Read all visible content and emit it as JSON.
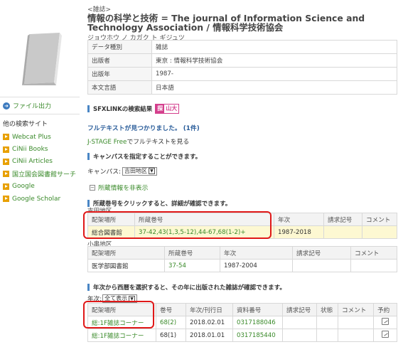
{
  "header": {
    "type_label": "<雑誌>",
    "title": "情報の科学と技術 = The journal of Information Science and Technology Association / 情報科学技術協会",
    "reading": "ジョウホウ ノ カガク ト ギジュツ"
  },
  "metadata": [
    {
      "key": "データ種別",
      "value": "雑誌"
    },
    {
      "key": "出版者",
      "value": "東京 : 情報科学技術協会"
    },
    {
      "key": "出版年",
      "value": "1987-"
    },
    {
      "key": "本文言語",
      "value": "日本語"
    }
  ],
  "sidebar": {
    "export_label": "ファイル出力",
    "other_sites_heading": "他の検索サイト",
    "sites": [
      {
        "label": "Webcat Plus"
      },
      {
        "label": "CiNii Books"
      },
      {
        "label": "CiNii Articles"
      },
      {
        "label": "国立国会図書館サーチ"
      },
      {
        "label": "Google"
      },
      {
        "label": "Google Scholar"
      }
    ]
  },
  "sfx": {
    "section_title": "SFXLINKの検索結果",
    "badge_left": "探",
    "badge_right": "山大",
    "found_message": "フルテキストが見つかりました。 (1件)",
    "jstage_link": "J-STAGE Free",
    "jstage_suffix": "でフルテキストを見る"
  },
  "campus": {
    "section_title": "キャンパスを指定することができます。",
    "label": "キャンパス:",
    "selected": "吉田地区"
  },
  "holdings": {
    "toggle_label": "所蔵情報を非表示",
    "section_title": "所蔵巻号をクリックすると、詳細が確認できます。",
    "headers": [
      "配架場所",
      "所蔵巻号",
      "年次",
      "請求記号",
      "コメント"
    ],
    "groups": [
      {
        "name": "吉田地区",
        "rows": [
          {
            "location": "総合図書館",
            "volumes": "37-42,43(1,3,5-12),44-67,68(1-2)+",
            "years": "1987-2018",
            "call_number": "",
            "comment": ""
          }
        ]
      },
      {
        "name": "小串地区",
        "rows": [
          {
            "location": "医学部図書館",
            "volumes": "37-54",
            "years": "1987-2004",
            "call_number": "",
            "comment": ""
          }
        ]
      }
    ]
  },
  "issues": {
    "section_title": "年次から西暦を選択すると、その年に出版された雑誌が確認できます。",
    "year_label": "年次:",
    "year_selected": "全て表示",
    "headers": [
      "配架場所",
      "巻号",
      "年次/刊行日",
      "資料番号",
      "請求記号",
      "状態",
      "コメント",
      "予約"
    ],
    "rows": [
      {
        "location": "総:1F雑誌コーナー",
        "volume": "68(2)",
        "date": "2018.02.01",
        "item_number": "0317188046",
        "call_number": "",
        "status": "",
        "comment": ""
      },
      {
        "location": "総:1F雑誌コーナー",
        "volume": "68(1)",
        "date": "2018.01.01",
        "item_number": "0317185440",
        "call_number": "",
        "status": "",
        "comment": ""
      }
    ]
  },
  "colors": {
    "link": "#3a8a2a",
    "accent_bar": "#4a86c5",
    "highlight_row": "#fdf8d2",
    "annotation": "#e01818",
    "sfx_badge": "#d43f8d"
  }
}
